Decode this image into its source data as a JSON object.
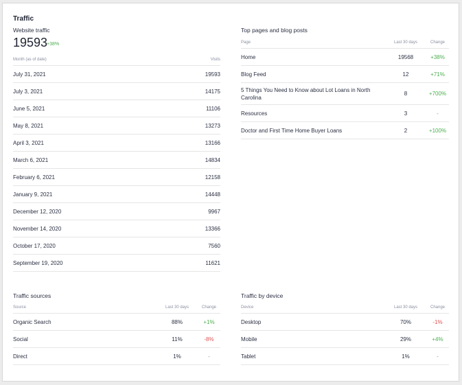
{
  "traffic": {
    "title": "Traffic",
    "website_traffic_label": "Website traffic",
    "total": "19593",
    "total_change": "+38%",
    "monthly": {
      "col_month": "Month (as of date)",
      "col_visits": "Visits",
      "rows": [
        {
          "month": "July 31, 2021",
          "visits": "19593"
        },
        {
          "month": "July 3, 2021",
          "visits": "14175"
        },
        {
          "month": "June 5, 2021",
          "visits": "11106"
        },
        {
          "month": "May 8, 2021",
          "visits": "13273"
        },
        {
          "month": "April 3, 2021",
          "visits": "13166"
        },
        {
          "month": "March 6, 2021",
          "visits": "14834"
        },
        {
          "month": "February 6, 2021",
          "visits": "12158"
        },
        {
          "month": "January 9, 2021",
          "visits": "14448"
        },
        {
          "month": "December 12, 2020",
          "visits": "9967"
        },
        {
          "month": "November 14, 2020",
          "visits": "13366"
        },
        {
          "month": "October 17, 2020",
          "visits": "7560"
        },
        {
          "month": "September 19, 2020",
          "visits": "11621"
        }
      ]
    }
  },
  "top_pages": {
    "title": "Top pages and blog posts",
    "col_page": "Page",
    "col_last30": "Last 30 days",
    "col_change": "Change",
    "rows": [
      {
        "page": "Home",
        "last30": "19568",
        "change": "+38%",
        "trend": "pos"
      },
      {
        "page": "Blog Feed",
        "last30": "12",
        "change": "+71%",
        "trend": "pos"
      },
      {
        "page": "5 Things You Need to Know about Lot Loans in North Carolina",
        "last30": "8",
        "change": "+700%",
        "trend": "pos"
      },
      {
        "page": "Resources",
        "last30": "3",
        "change": "-",
        "trend": "neu"
      },
      {
        "page": "Doctor and First Time Home Buyer Loans",
        "last30": "2",
        "change": "+100%",
        "trend": "pos"
      }
    ]
  },
  "traffic_sources": {
    "title": "Traffic sources",
    "col_source": "Source",
    "col_last30": "Last 30 days",
    "col_change": "Change",
    "rows": [
      {
        "name": "Organic Search",
        "last30": "88%",
        "change": "+1%",
        "trend": "pos"
      },
      {
        "name": "Social",
        "last30": "11%",
        "change": "-8%",
        "trend": "neg"
      },
      {
        "name": "Direct",
        "last30": "1%",
        "change": "-",
        "trend": "neu"
      }
    ]
  },
  "traffic_device": {
    "title": "Traffic by device",
    "col_device": "Device",
    "col_last30": "Last 30 days",
    "col_change": "Change",
    "rows": [
      {
        "name": "Desktop",
        "last30": "70%",
        "change": "-1%",
        "trend": "neg"
      },
      {
        "name": "Mobile",
        "last30": "29%",
        "change": "+4%",
        "trend": "pos"
      },
      {
        "name": "Tablet",
        "last30": "1%",
        "change": "-",
        "trend": "neu"
      }
    ]
  },
  "colors": {
    "positive": "#4caf50",
    "negative": "#e05252",
    "neutral": "#8a8fa0"
  }
}
